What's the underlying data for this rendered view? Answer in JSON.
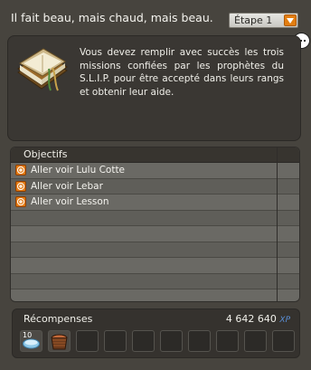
{
  "header": {
    "title": "Il fait beau, mais chaud, mais beau.",
    "step_label": "Étape 1",
    "step_arrow_icon": "chevron-down-icon",
    "chat_icon": "speech-bubble-icon"
  },
  "description": {
    "icon": "book-icon",
    "text": "Vous devez remplir avec succès les trois missions confiées par les prophètes du S.L.I.P. pour être accepté dans leurs rangs et obtenir leur aide."
  },
  "objectives": {
    "header": "Objectifs",
    "items": [
      {
        "label": "Aller voir Lulu Cotte",
        "icon": "plus-icon"
      },
      {
        "label": "Aller voir Lebar",
        "icon": "plus-icon"
      },
      {
        "label": "Aller voir Lesson",
        "icon": "plus-icon"
      }
    ]
  },
  "rewards": {
    "title": "Récompenses",
    "xp_amount": "4 642 640",
    "xp_unit": "XP",
    "items": [
      {
        "icon": "blue-dish-icon",
        "quantity": "10"
      },
      {
        "icon": "basket-icon",
        "quantity": ""
      }
    ]
  },
  "colors": {
    "accent": "#e37e10",
    "xp": "#5a8fd6"
  }
}
